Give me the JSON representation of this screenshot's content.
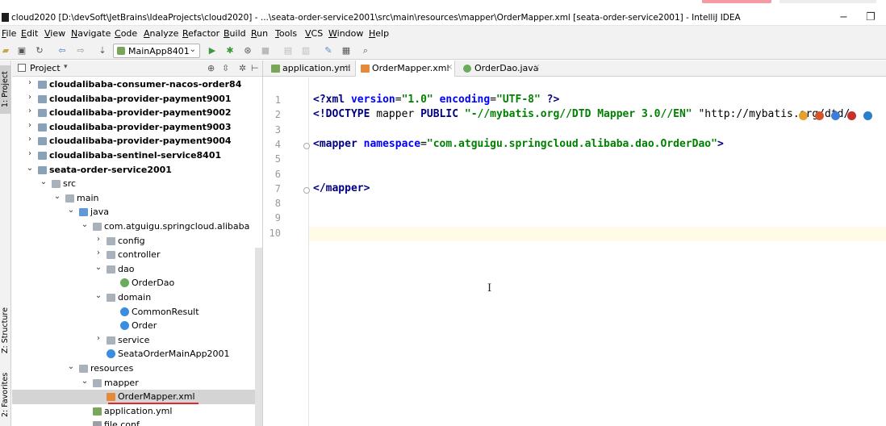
{
  "window": {
    "title": "cloud2020 [D:\\devSoft\\JetBrains\\IdeaProjects\\cloud2020] - ...\\seata-order-service2001\\src\\main\\resources\\mapper\\OrderMapper.xml [seata-order-service2001] - IntelliJ IDEA",
    "minimize": "−",
    "restore": "❐"
  },
  "menu": [
    "File",
    "Edit",
    "View",
    "Navigate",
    "Code",
    "Analyze",
    "Refactor",
    "Build",
    "Run",
    "Tools",
    "VCS",
    "Window",
    "Help"
  ],
  "toolbar": {
    "run_config": "MainApp8401"
  },
  "side_tabs": {
    "project": "1: Project",
    "structure": "Z: Structure",
    "favorites": "2: Favorites"
  },
  "project_panel": {
    "title": "Project",
    "dropdown": "▾"
  },
  "tree": [
    {
      "label": "cloudalibaba-consumer-nacos-order84",
      "level": 1,
      "icon": "module",
      "arrow": "›",
      "bold": true
    },
    {
      "label": "cloudalibaba-provider-payment9001",
      "level": 1,
      "icon": "module",
      "arrow": "›",
      "bold": true
    },
    {
      "label": "cloudalibaba-provider-payment9002",
      "level": 1,
      "icon": "module",
      "arrow": "›",
      "bold": true
    },
    {
      "label": "cloudalibaba-provider-payment9003",
      "level": 1,
      "icon": "module",
      "arrow": "›",
      "bold": true
    },
    {
      "label": "cloudalibaba-provider-payment9004",
      "level": 1,
      "icon": "module",
      "arrow": "›",
      "bold": true
    },
    {
      "label": "cloudalibaba-sentinel-service8401",
      "level": 1,
      "icon": "module",
      "arrow": "›",
      "bold": true
    },
    {
      "label": "seata-order-service2001",
      "level": 1,
      "icon": "module",
      "arrow": "⌄",
      "bold": true
    },
    {
      "label": "src",
      "level": 2,
      "icon": "folder",
      "arrow": "⌄"
    },
    {
      "label": "main",
      "level": 3,
      "icon": "folder",
      "arrow": "⌄"
    },
    {
      "label": "java",
      "level": 4,
      "icon": "srcfolder",
      "arrow": "⌄"
    },
    {
      "label": "com.atguigu.springcloud.alibaba",
      "level": 5,
      "icon": "pkg",
      "arrow": "⌄"
    },
    {
      "label": "config",
      "level": 6,
      "icon": "pkg",
      "arrow": "›"
    },
    {
      "label": "controller",
      "level": 6,
      "icon": "pkg",
      "arrow": "›"
    },
    {
      "label": "dao",
      "level": 6,
      "icon": "pkg",
      "arrow": "⌄"
    },
    {
      "label": "OrderDao",
      "level": 7,
      "icon": "iface",
      "arrow": ""
    },
    {
      "label": "domain",
      "level": 6,
      "icon": "pkg",
      "arrow": "⌄"
    },
    {
      "label": "CommonResult",
      "level": 7,
      "icon": "cls",
      "arrow": ""
    },
    {
      "label": "Order",
      "level": 7,
      "icon": "cls",
      "arrow": ""
    },
    {
      "label": "service",
      "level": 6,
      "icon": "pkg",
      "arrow": "›"
    },
    {
      "label": "SeataOrderMainApp2001",
      "level": 6,
      "icon": "main",
      "arrow": ""
    },
    {
      "label": "resources",
      "level": 4,
      "icon": "folder",
      "arrow": "⌄"
    },
    {
      "label": "mapper",
      "level": 5,
      "icon": "folder",
      "arrow": "⌄"
    },
    {
      "label": "OrderMapper.xml",
      "level": 6,
      "icon": "xml",
      "arrow": "",
      "selected": true
    },
    {
      "label": "application.yml",
      "level": 5,
      "icon": "yml",
      "arrow": ""
    },
    {
      "label": "file.conf",
      "level": 5,
      "icon": "file",
      "arrow": ""
    }
  ],
  "tabs": [
    {
      "label": "application.yml",
      "icon": "yml",
      "active": false
    },
    {
      "label": "OrderMapper.xml",
      "icon": "xml",
      "active": true
    },
    {
      "label": "OrderDao.java",
      "icon": "iface",
      "active": false
    }
  ],
  "close_glyph": "×",
  "editor": {
    "line_numbers": [
      "1",
      "2",
      "3",
      "4",
      "5",
      "6",
      "7",
      "8",
      "9",
      "10"
    ],
    "current_line": 10,
    "lines": [
      "<?xml version=\"1.0\" encoding=\"UTF-8\" ?>",
      "<!DOCTYPE mapper PUBLIC \"-//mybatis.org//DTD Mapper 3.0//EN\" \"http://mybatis.org/dtd/",
      "",
      "<mapper namespace=\"com.atguigu.springcloud.alibaba.dao.OrderDao\">",
      "",
      "",
      "</mapper>",
      "",
      "",
      ""
    ]
  },
  "colors": {
    "keyword": "#000080",
    "attr": "#0000ff",
    "string": "#008000",
    "selection": "#d4d4d4",
    "underline": "#e0282e"
  }
}
